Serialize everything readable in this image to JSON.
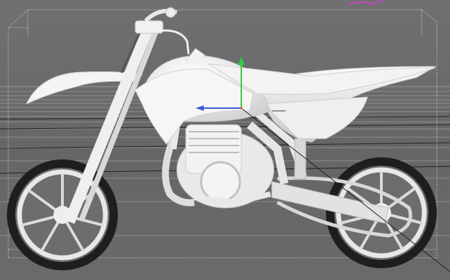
{
  "viewport": {
    "background": "#6b6b6b",
    "object_color": "#f0f0f0",
    "bbox_color": "#e6e6e6",
    "gizmo": {
      "y_axis_color": "#2ecc40",
      "x_axis_color": "#3b5bd6",
      "z_axis_color": "#1f1f1f"
    },
    "corner_mark_color": "#d040d0"
  },
  "model": {
    "icon": "motorcycle-model-icon"
  }
}
